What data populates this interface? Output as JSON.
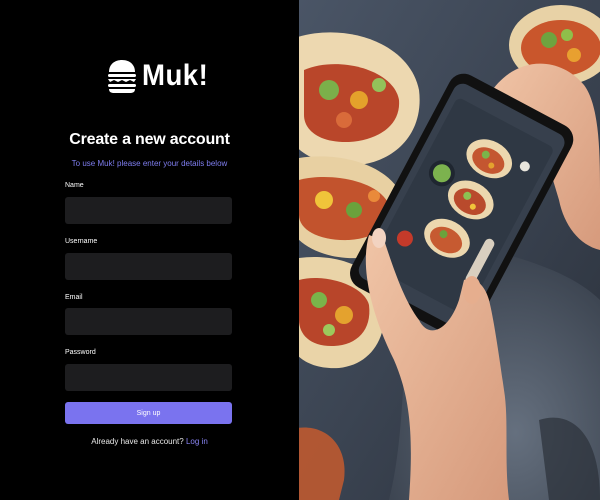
{
  "brand": {
    "name": "Muk!",
    "icon": "burger-icon"
  },
  "signup": {
    "title": "Create a new account",
    "subtitle": "To use Muk! please enter your details below",
    "fields": [
      {
        "label": "Name",
        "value": "",
        "placeholder": ""
      },
      {
        "label": "Username",
        "value": "",
        "placeholder": ""
      },
      {
        "label": "Email",
        "value": "",
        "placeholder": ""
      },
      {
        "label": "Password",
        "value": "",
        "placeholder": ""
      }
    ],
    "submit_label": "Sign up",
    "login_prompt": "Already have an account?",
    "login_link": "Log in"
  },
  "colors": {
    "background": "#000000",
    "input_background": "#1d1d1f",
    "accent": "#7a73ef",
    "subtitle": "#7f7ef0"
  },
  "hero_image": {
    "icon": "phone-photographing-tacos-image"
  }
}
